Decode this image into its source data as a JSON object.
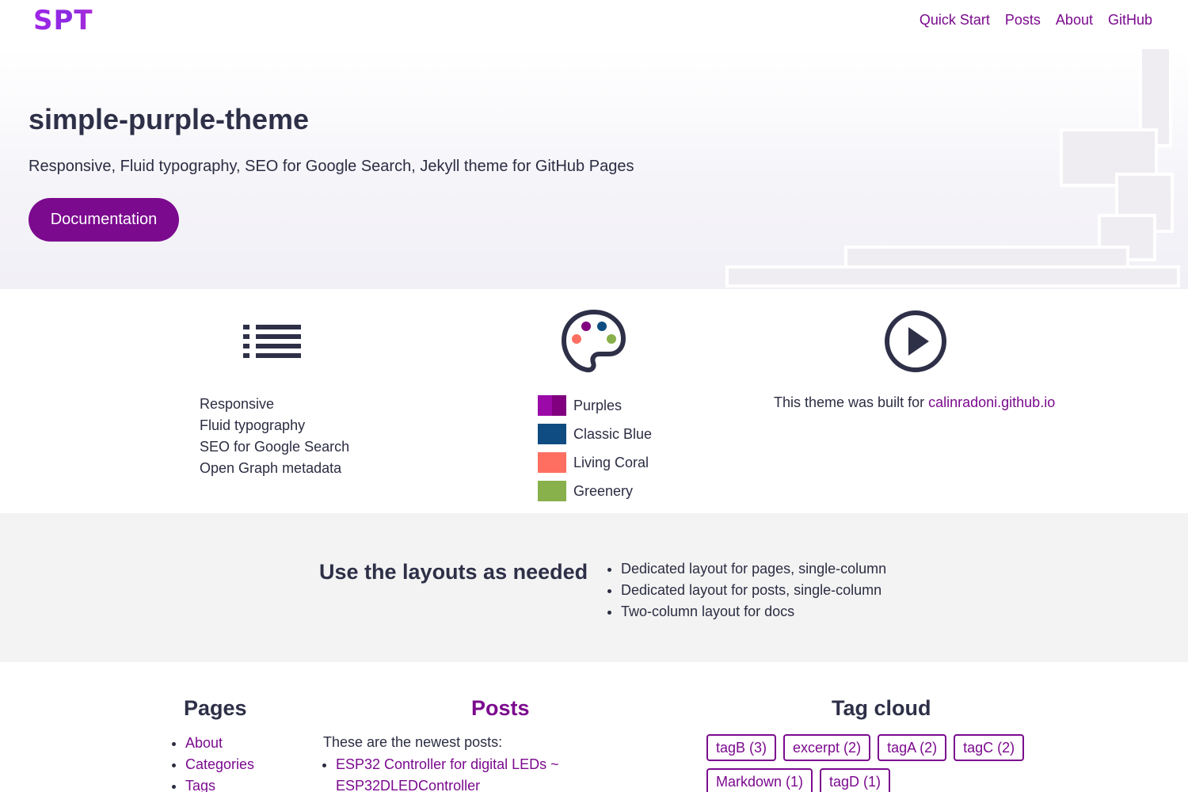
{
  "header": {
    "logo": "SPT",
    "nav": [
      "Quick Start",
      "Posts",
      "About",
      "GitHub"
    ]
  },
  "hero": {
    "title": "simple-purple-theme",
    "subtitle": "Responsive, Fluid typography, SEO for Google Search, Jekyll theme for GitHub Pages",
    "button": "Documentation"
  },
  "features": {
    "list_icon": "list-icon",
    "palette_icon": "palette-icon",
    "play_icon": "play-circle-icon",
    "items": [
      "Responsive",
      "Fluid typography",
      "SEO for Google Search",
      "Open Graph metadata"
    ],
    "palettes": [
      {
        "label": "Purples",
        "color": "#800080"
      },
      {
        "label": "Classic Blue",
        "color": "#0f4c81"
      },
      {
        "label": "Living Coral",
        "color": "#ff6f61"
      },
      {
        "label": "Greenery",
        "color": "#88b04b"
      }
    ],
    "built_prefix": "This theme was built for",
    "built_link": "calinradoni.github.io"
  },
  "layouts": {
    "title": "Use the layouts as needed",
    "items": [
      "Dedicated layout for pages, single-column",
      "Dedicated layout for posts, single-column",
      "Two-column layout for docs"
    ]
  },
  "footer": {
    "pages_title": "Pages",
    "pages": [
      "About",
      "Categories",
      "Tags"
    ],
    "posts_title": "Posts",
    "posts_intro": "These are the newest posts:",
    "posts": [
      "ESP32 Controller for digital LEDs ~ ESP32DLEDController"
    ],
    "tags_title": "Tag cloud",
    "tags": [
      "tagB (3)",
      "excerpt (2)",
      "tagA (2)",
      "tagC (2)",
      "Markdown (1)",
      "tagD (1)"
    ]
  },
  "colors": {
    "accent": "#7b0a8e",
    "text": "#2b2d42",
    "band": "#f3f3f3"
  }
}
